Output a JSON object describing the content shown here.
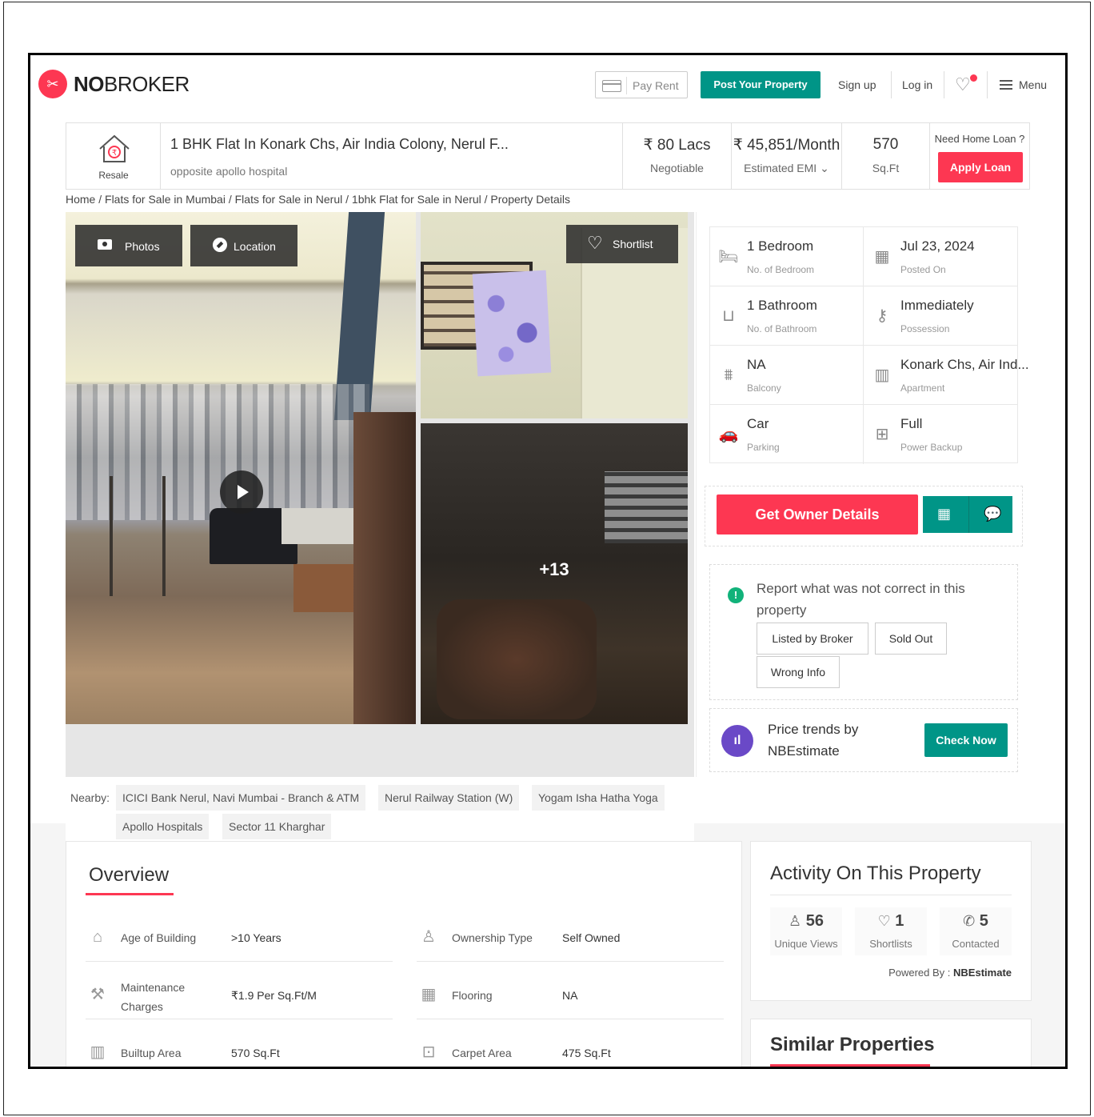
{
  "header": {
    "logo_icon": "nobroker-logo-icon",
    "logo_text_bold": "NO",
    "logo_text_rest": "BROKER",
    "pay_rent": "Pay Rent",
    "post_property": "Post Your Property",
    "sign_up": "Sign up",
    "log_in": "Log in",
    "menu": "Menu"
  },
  "summary": {
    "type_label": "Resale",
    "title": "1 BHK Flat In Konark Chs, Air India Colony, Nerul F...",
    "subtitle": "opposite apollo hospital",
    "price": "₹ 80 Lacs",
    "price_note": "Negotiable",
    "emi": "₹ 45,851/Month",
    "emi_note": "Estimated EMI",
    "area": "570",
    "area_unit": "Sq.Ft",
    "loan_question": "Need Home Loan ?",
    "apply_loan": "Apply Loan"
  },
  "breadcrumb": "Home / Flats for Sale in Mumbai / Flats for Sale in Nerul / 1bhk Flat for Sale in Nerul / Property Details",
  "gallery": {
    "photos": "Photos",
    "location": "Location",
    "shortlist": "Shortlist",
    "more_count": "+13"
  },
  "specs": [
    {
      "value": "1 Bedroom",
      "label": "No. of Bedroom",
      "icon": "bed-icon"
    },
    {
      "value": "Jul 23, 2024",
      "label": "Posted On",
      "icon": "calendar-icon"
    },
    {
      "value": "1 Bathroom",
      "label": "No. of Bathroom",
      "icon": "bathtub-icon"
    },
    {
      "value": "Immediately",
      "label": "Possession",
      "icon": "key-icon"
    },
    {
      "value": "NA",
      "label": "Balcony",
      "icon": "balcony-icon"
    },
    {
      "value": "Konark Chs, Air Ind...",
      "label": "Apartment",
      "icon": "building-icon"
    },
    {
      "value": "Car",
      "label": "Parking",
      "icon": "car-icon"
    },
    {
      "value": "Full",
      "label": "Power Backup",
      "icon": "battery-icon"
    }
  ],
  "cta": {
    "owner_details": "Get Owner Details"
  },
  "report": {
    "text": "Report what was not correct in this property",
    "options": [
      "Listed by Broker",
      "Sold Out",
      "Wrong Info"
    ]
  },
  "trend": {
    "text": "Price trends by NBEstimate",
    "button": "Check Now"
  },
  "nearby": {
    "label": "Nearby:",
    "places": [
      "ICICI Bank Nerul, Navi Mumbai - Branch & ATM",
      "Nerul Railway Station (W)",
      "Yogam Isha Hatha Yoga",
      "Apollo Hospitals",
      "Sector 11 Kharghar"
    ]
  },
  "overview": {
    "title": "Overview",
    "rows": [
      {
        "key": "Age of Building",
        "value": ">10 Years",
        "icon": "cake-icon"
      },
      {
        "key": "Ownership Type",
        "value": "Self Owned",
        "icon": "owner-icon"
      },
      {
        "key": "Maintenance Charges",
        "value": "₹1.9 Per Sq.Ft/M",
        "icon": "tools-icon"
      },
      {
        "key": "Flooring",
        "value": "NA",
        "icon": "tiles-icon"
      },
      {
        "key": "Builtup Area",
        "value": "570 Sq.Ft",
        "icon": "building-area-icon"
      },
      {
        "key": "Carpet Area",
        "value": "475 Sq.Ft",
        "icon": "carpet-icon"
      }
    ]
  },
  "activity": {
    "title": "Activity On This Property",
    "stats": [
      {
        "value": "56",
        "label": "Unique Views",
        "icon": "user-icon"
      },
      {
        "value": "1",
        "label": "Shortlists",
        "icon": "heart-icon"
      },
      {
        "value": "5",
        "label": "Contacted",
        "icon": "phone-icon"
      }
    ],
    "powered_label": "Powered By :",
    "powered_value": "NBEstimate"
  },
  "similar": {
    "title": "Similar Properties"
  },
  "colors": {
    "brand_red": "#fd3752",
    "brand_teal": "#009587",
    "trend_purple": "#6a49c7"
  }
}
